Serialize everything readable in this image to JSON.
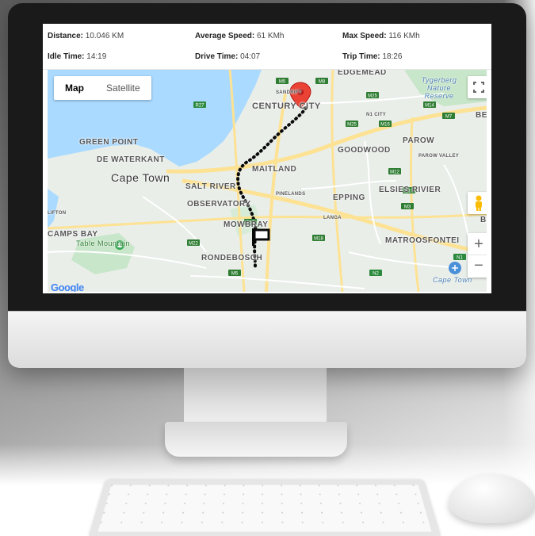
{
  "stats": {
    "distance_label": "Distance:",
    "distance_value": "10.046 KM",
    "avg_speed_label": "Average Speed:",
    "avg_speed_value": "61 KMh",
    "max_speed_label": "Max Speed:",
    "max_speed_value": "116 KMh",
    "idle_label": "Idle Time:",
    "idle_value": "14:19",
    "drive_label": "Drive Time:",
    "drive_value": "04:07",
    "trip_label": "Trip Time:",
    "trip_value": "18:26"
  },
  "map": {
    "type_map": "Map",
    "type_satellite": "Satellite",
    "zoom_in": "+",
    "zoom_out": "−",
    "attribution": "Google",
    "labels": {
      "edgemead": "EDGEMEAD",
      "sandrift": "SANDRIFT",
      "century_city": "CENTURY CITY",
      "tygerberg": "Tygerberg Nature Reserve",
      "n1_city": "N1 CITY",
      "bellville": "BELL",
      "green_point": "GREEN POINT",
      "de_waterkant": "DE WATERKANT",
      "goodwood": "GOODWOOD",
      "parow": "PAROW",
      "parow_valley": "PAROW VALLEY",
      "maitland": "MAITLAND",
      "cape_town": "Cape Town",
      "salt_river": "SALT RIVER",
      "pinelands": "PINELANDS",
      "epping": "EPPING",
      "elsies_rivier": "ELSIES RIVIER",
      "clifton": "LIFTON",
      "observatory": "OBSERVATORY",
      "langa": "LANGA",
      "camps_bay": "CAMPS BAY",
      "mowbray": "MOWBRAY",
      "table_mountain": "Table Mountain",
      "matroosfontein": "MATROOSFONTEI",
      "rondebosch": "RONDEBOSCH",
      "cape_town_airport": "Cape Town",
      "right_edge": "B"
    },
    "road_shields": [
      "M5",
      "M8",
      "M25",
      "M14",
      "M7",
      "M25",
      "M16",
      "M12",
      "M17",
      "M3",
      "M4",
      "M18",
      "M5",
      "M22",
      "N2",
      "N1",
      "R27"
    ]
  },
  "colors": {
    "water": "#aadaff",
    "land": "#e9eee9",
    "major_road": "#fde293",
    "road": "#ffffff",
    "park": "#c8e6c9",
    "route": "#0a0a0a",
    "pin": "#ea4335",
    "shield": "#2e7d32"
  }
}
